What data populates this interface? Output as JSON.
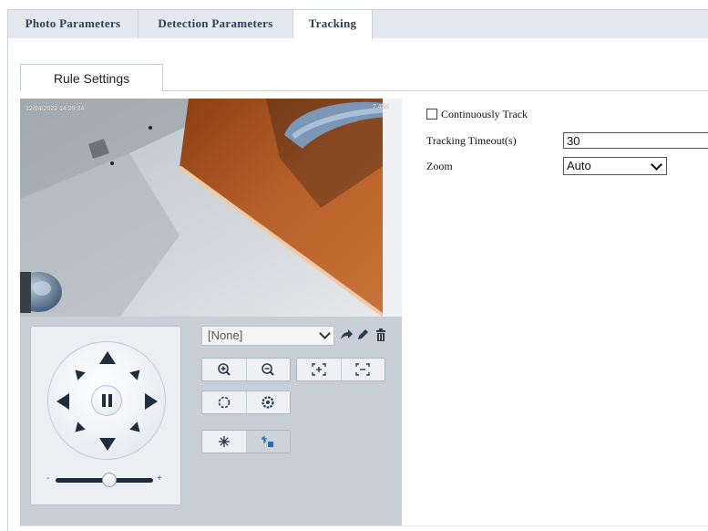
{
  "top_tabs": [
    {
      "label": "Photo Parameters",
      "active": false
    },
    {
      "label": "Detection Parameters",
      "active": false
    },
    {
      "label": "Tracking",
      "active": true
    }
  ],
  "sub_tab": {
    "label": "Rule Settings"
  },
  "video": {
    "osd_timestamp": "12/04/2022 14:29:24",
    "osd_zoom": "7.40X"
  },
  "ptz": {
    "preset_select": {
      "value": "[None]"
    },
    "icons": {
      "goto": "goto-arrow-icon",
      "edit": "pencil-icon",
      "delete": "trash-icon",
      "up": "arrow-up-icon",
      "down": "arrow-down-icon",
      "left": "arrow-left-icon",
      "right": "arrow-right-icon",
      "pause": "pause-icon",
      "zoom_in": "zoom-in-icon",
      "zoom_out": "zoom-out-icon",
      "focus_near": "focus-near-icon",
      "focus_far": "focus-far-icon",
      "iris_open": "iris-open-icon",
      "iris_close": "iris-close-icon",
      "light": "light-icon",
      "wiper": "wiper-icon"
    },
    "speed_slider": {
      "minus": "-",
      "plus": "+",
      "level": 0.55
    }
  },
  "form": {
    "continuously_track": {
      "label": "Continuously Track",
      "checked": false
    },
    "tracking_timeout": {
      "label": "Tracking Timeout(s)",
      "value": "30"
    },
    "zoom": {
      "label": "Zoom",
      "value": "Auto"
    }
  },
  "colors": {
    "tab_bar_bg": "#e4e9ef",
    "tab_text": "#2c3e56",
    "ptz_panel_bg": "#c9cfd6",
    "arrow": "#1f2d3d",
    "icon_accent": "#2a6fb0"
  }
}
